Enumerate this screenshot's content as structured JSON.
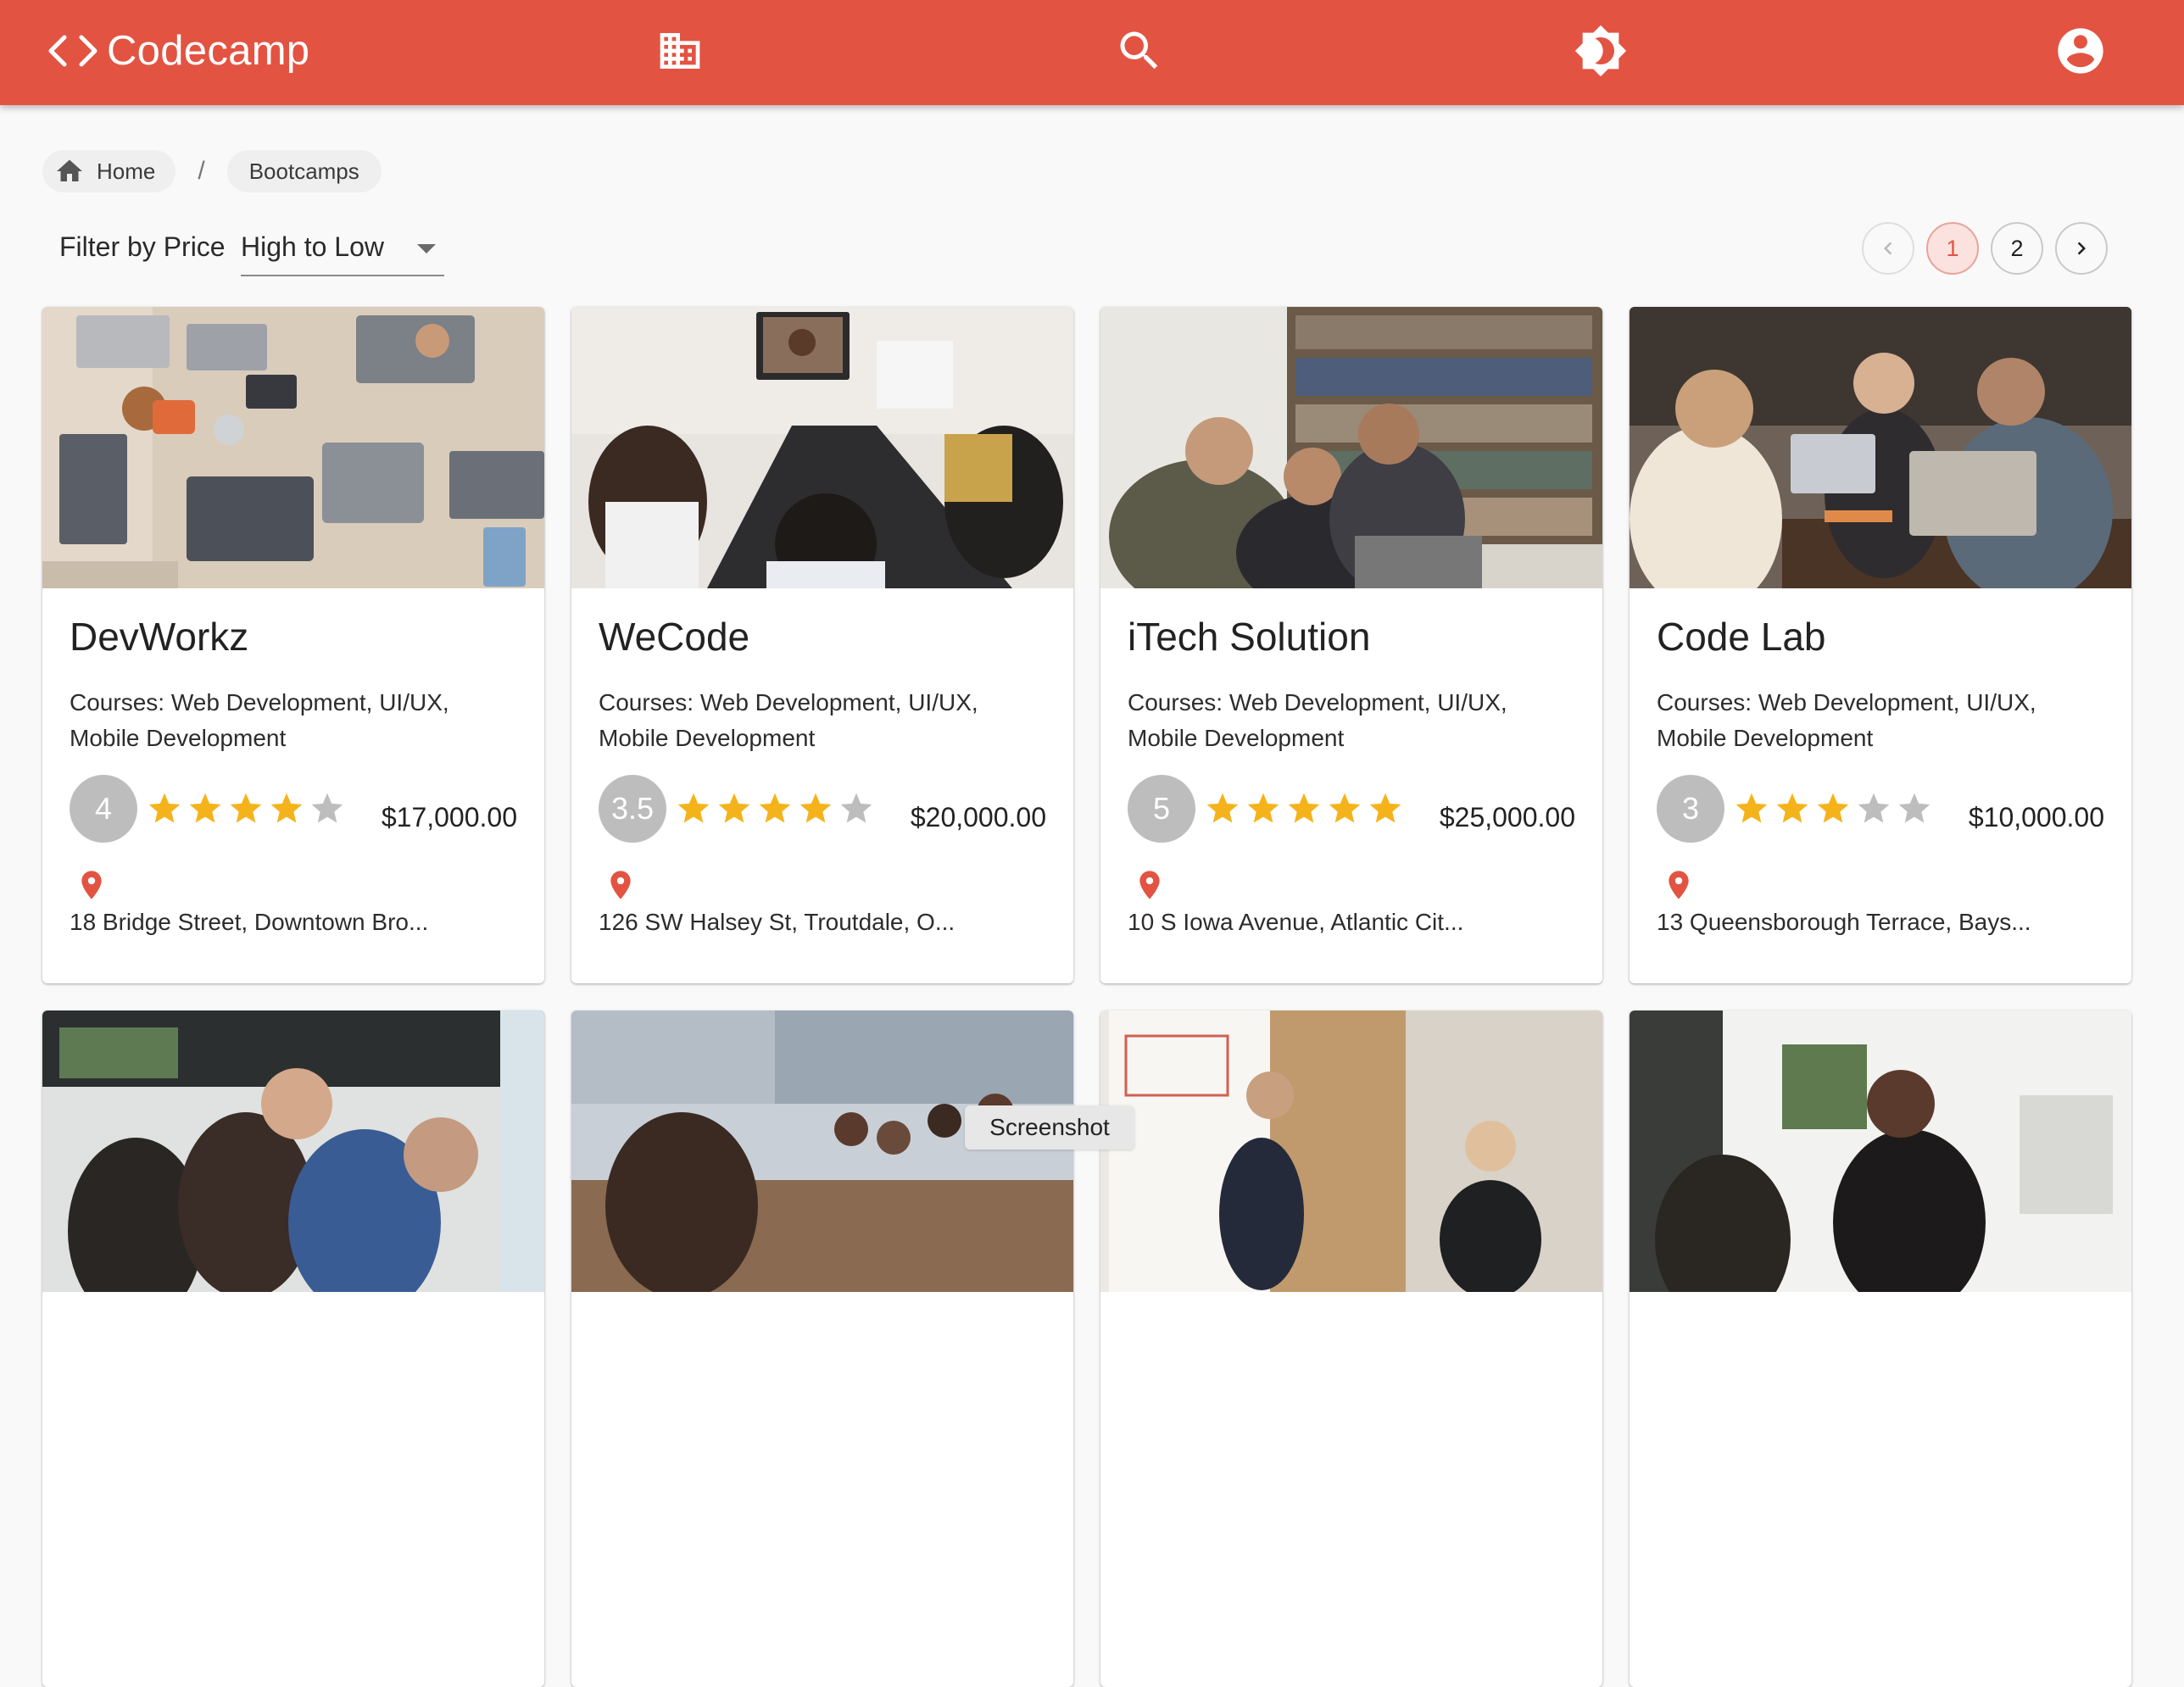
{
  "app": {
    "brand": "Codecamp",
    "primary_color": "#e35342",
    "nav_icons": [
      "code-brackets-icon",
      "business-icon",
      "search-icon",
      "brightness-icon",
      "account-circle-icon"
    ]
  },
  "breadcrumb": {
    "home": "Home",
    "separator": "/",
    "current": "Bootcamps"
  },
  "filter": {
    "label": "Filter by Price",
    "selected": "High to Low"
  },
  "pagination": {
    "pages": [
      "1",
      "2"
    ],
    "current_page": "1"
  },
  "bootcamps": [
    {
      "name": "DevWorkz",
      "courses": "Courses: Web Development, UI/UX, Mobile Development",
      "rating": "4",
      "rating_value": 4,
      "price": "$17,000.00",
      "address": "18 Bridge Street, Downtown Bro..."
    },
    {
      "name": "WeCode",
      "courses": "Courses: Web Development, UI/UX, Mobile Development",
      "rating": "3.5",
      "rating_value": 3.5,
      "price": "$20,000.00",
      "address": "126 SW Halsey St, Troutdale, O..."
    },
    {
      "name": "iTech Solution",
      "courses": "Courses: Web Development, UI/UX, Mobile Development",
      "rating": "5",
      "rating_value": 5,
      "price": "$25,000.00",
      "address": "10 S Iowa Avenue, Atlantic Cit..."
    },
    {
      "name": "Code Lab",
      "courses": "Courses: Web Development, UI/UX, Mobile Development",
      "rating": "3",
      "rating_value": 3,
      "price": "$10,000.00",
      "address": "13 Queensborough Terrace, Bays..."
    }
  ],
  "tooltip": "Screenshot"
}
